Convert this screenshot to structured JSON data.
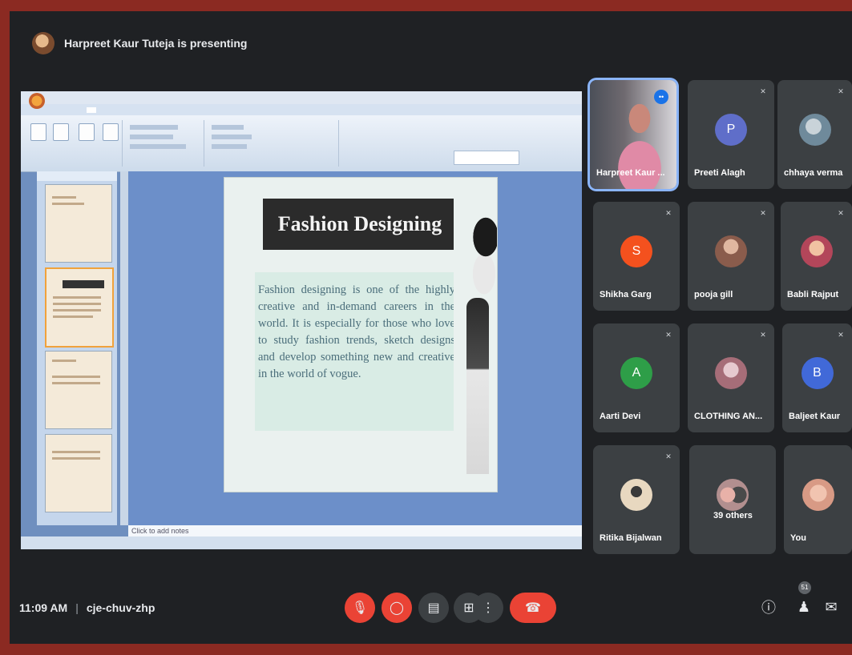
{
  "meeting": {
    "presenter_label": "Harpreet Kaur Tuteja is presenting",
    "time": "11:09 AM",
    "separator": "|",
    "code": "cje-chuv-zhp",
    "participant_badge": "51"
  },
  "slide": {
    "title": "Fashion Designing",
    "body": "Fashion designing is one of the highly creative and in-demand careers in the world. It is especially for those who love to study fashion trends, sketch designs and develop something new and creative in the world of vogue."
  },
  "ppt": {
    "notes_placeholder": "Click to add notes"
  },
  "participants": [
    {
      "name": "Harpreet Kaur ...",
      "type": "video",
      "speaking": true
    },
    {
      "name": "Preeti Alagh",
      "type": "letter",
      "letter": "P",
      "color": "#5f6ec9"
    },
    {
      "name": "chhaya verma",
      "type": "photo",
      "color": "#6f8a9b"
    },
    {
      "name": "Shikha Garg",
      "type": "letter",
      "letter": "S",
      "color": "#f4511e"
    },
    {
      "name": "pooja gill",
      "type": "photo",
      "color": "#b08a7a"
    },
    {
      "name": "Babli Rajput",
      "type": "photo",
      "color": "#d07a86"
    },
    {
      "name": "Aarti Devi",
      "type": "letter",
      "letter": "A",
      "color": "#2e9e48"
    },
    {
      "name": "CLOTHING AN...",
      "type": "photo",
      "color": "#a66d78"
    },
    {
      "name": "Baljeet Kaur",
      "type": "letter",
      "letter": "B",
      "color": "#4169d8"
    },
    {
      "name": "Ritika Bijalwan",
      "type": "photo",
      "color": "#c9b69a"
    },
    {
      "name": "39 others",
      "type": "photo",
      "color": "#b28f8f"
    },
    {
      "name": "You",
      "type": "photo",
      "color": "#d89a85"
    }
  ],
  "controls": {
    "mic_icon": "mic-off-icon",
    "cam_icon": "camera-off-icon",
    "captions_icon": "captions-icon",
    "present_icon": "present-icon",
    "more_icon": "more-options-icon",
    "hangup_icon": "hang-up-icon",
    "info_icon": "info-icon",
    "people_icon": "people-icon",
    "chat_icon": "chat-icon"
  },
  "colors": {
    "meet_bg": "#1f2124",
    "tile_bg": "#3c4043",
    "danger": "#ea4335",
    "accent": "#8ab4f8"
  }
}
